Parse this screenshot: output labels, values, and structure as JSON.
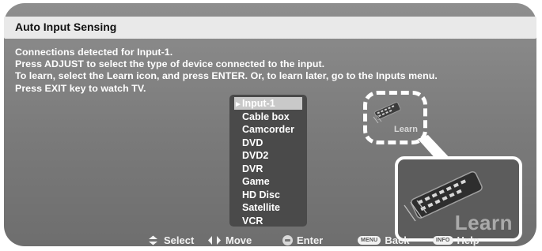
{
  "header": {
    "title": "Auto Input Sensing"
  },
  "instructions": [
    "Connections detected for Input-1.",
    "Press ADJUST to select the type of device connected to the input.",
    "To learn, select the Learn icon, and press ENTER.  Or, to learn later, go to the Inputs menu.",
    "Press EXIT key to watch TV."
  ],
  "device_list": {
    "selected_marker": "►",
    "items": [
      "Input-1",
      "Cable box",
      "Camcorder",
      "DVD",
      "DVD2",
      "DVR",
      "Game",
      "HD Disc",
      "Satellite",
      "VCR"
    ],
    "selected_index": 0
  },
  "learn": {
    "small_label": "Learn",
    "big_label": "Learn",
    "icon": "remote-control-icon"
  },
  "footer": {
    "select": {
      "icon": "up-down-arrows-icon",
      "label": "Select"
    },
    "move": {
      "icon": "left-right-arrows-icon",
      "label": "Move"
    },
    "enter": {
      "icon": "enter-button-icon",
      "label": "Enter"
    },
    "back": {
      "badge": "MENU",
      "label": "Back"
    },
    "help": {
      "badge": "INFO",
      "label": "Help"
    }
  },
  "colors": {
    "screen_bg": "#7a7a7a",
    "titlebar_bg": "#e9e9e9",
    "list_bg": "#4a4a4a",
    "highlight": "#c9c9c9"
  }
}
